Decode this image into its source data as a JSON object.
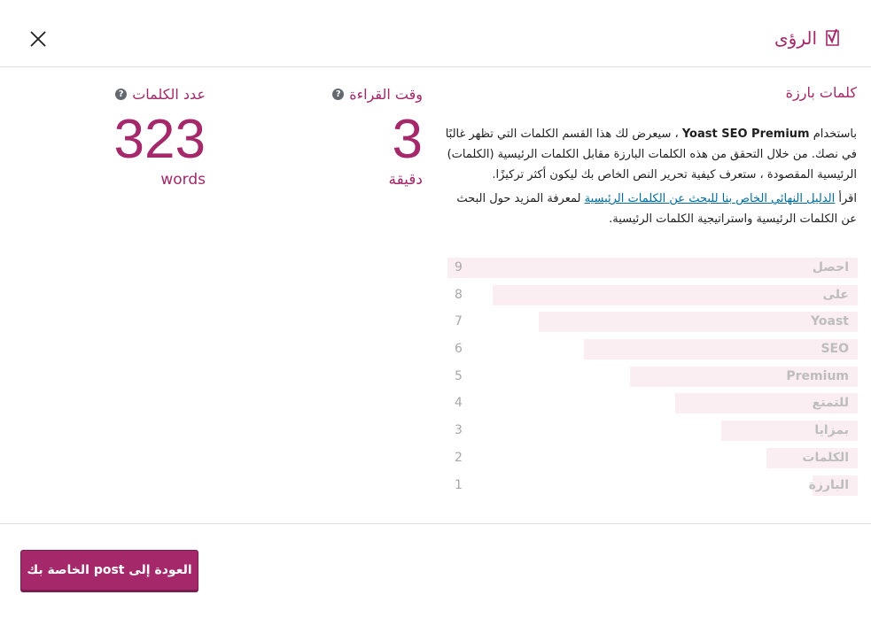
{
  "header": {
    "title": "الرؤى",
    "close_label": "close"
  },
  "prominent_words": {
    "title": "كلمات بارزة",
    "description_before": "باستخدام ",
    "description_product": "Yoast SEO Premium",
    "description_after": " ، سيعرض لك هذا القسم الكلمات التي تظهر غالبًا في نصك. من خلال التحقق من هذه الكلمات البارزة مقابل الكلمات الرئيسية (الكلمات) الرئيسية المقصودة ، ستعرف كيفية تحرير النص الخاص بك ليكون أكثر تركيزًا.",
    "guide_before": "اقرأ ",
    "guide_link": "الدليل النهائي الخاص بنا للبحث عن الكلمات الرئيسية",
    "guide_after": " لمعرفة المزيد حول البحث عن الكلمات الرئيسية واستراتيجية الكلمات الرئيسية.",
    "words": [
      {
        "word": "احصل",
        "count": 9
      },
      {
        "word": "على",
        "count": 8
      },
      {
        "word": "Yoast",
        "count": 7
      },
      {
        "word": "SEO",
        "count": 6
      },
      {
        "word": "Premium",
        "count": 5
      },
      {
        "word": "للتمتع",
        "count": 4
      },
      {
        "word": "بمزايا",
        "count": 3
      },
      {
        "word": "الكلمات",
        "count": 2
      },
      {
        "word": "البارزة",
        "count": 1
      }
    ]
  },
  "reading_time": {
    "label": "وقت القراءة",
    "value": "3",
    "unit": "دقيقة"
  },
  "word_count": {
    "label": "عدد الكلمات",
    "value": "323",
    "unit": "words"
  },
  "footer": {
    "back_button": "العودة إلى post الخاصة بك"
  },
  "colors": {
    "accent": "#a4286a",
    "bar": "#fbeef2"
  },
  "icons": {
    "close": "close-icon",
    "logo": "yoast-logo-icon",
    "help": "help-icon"
  }
}
